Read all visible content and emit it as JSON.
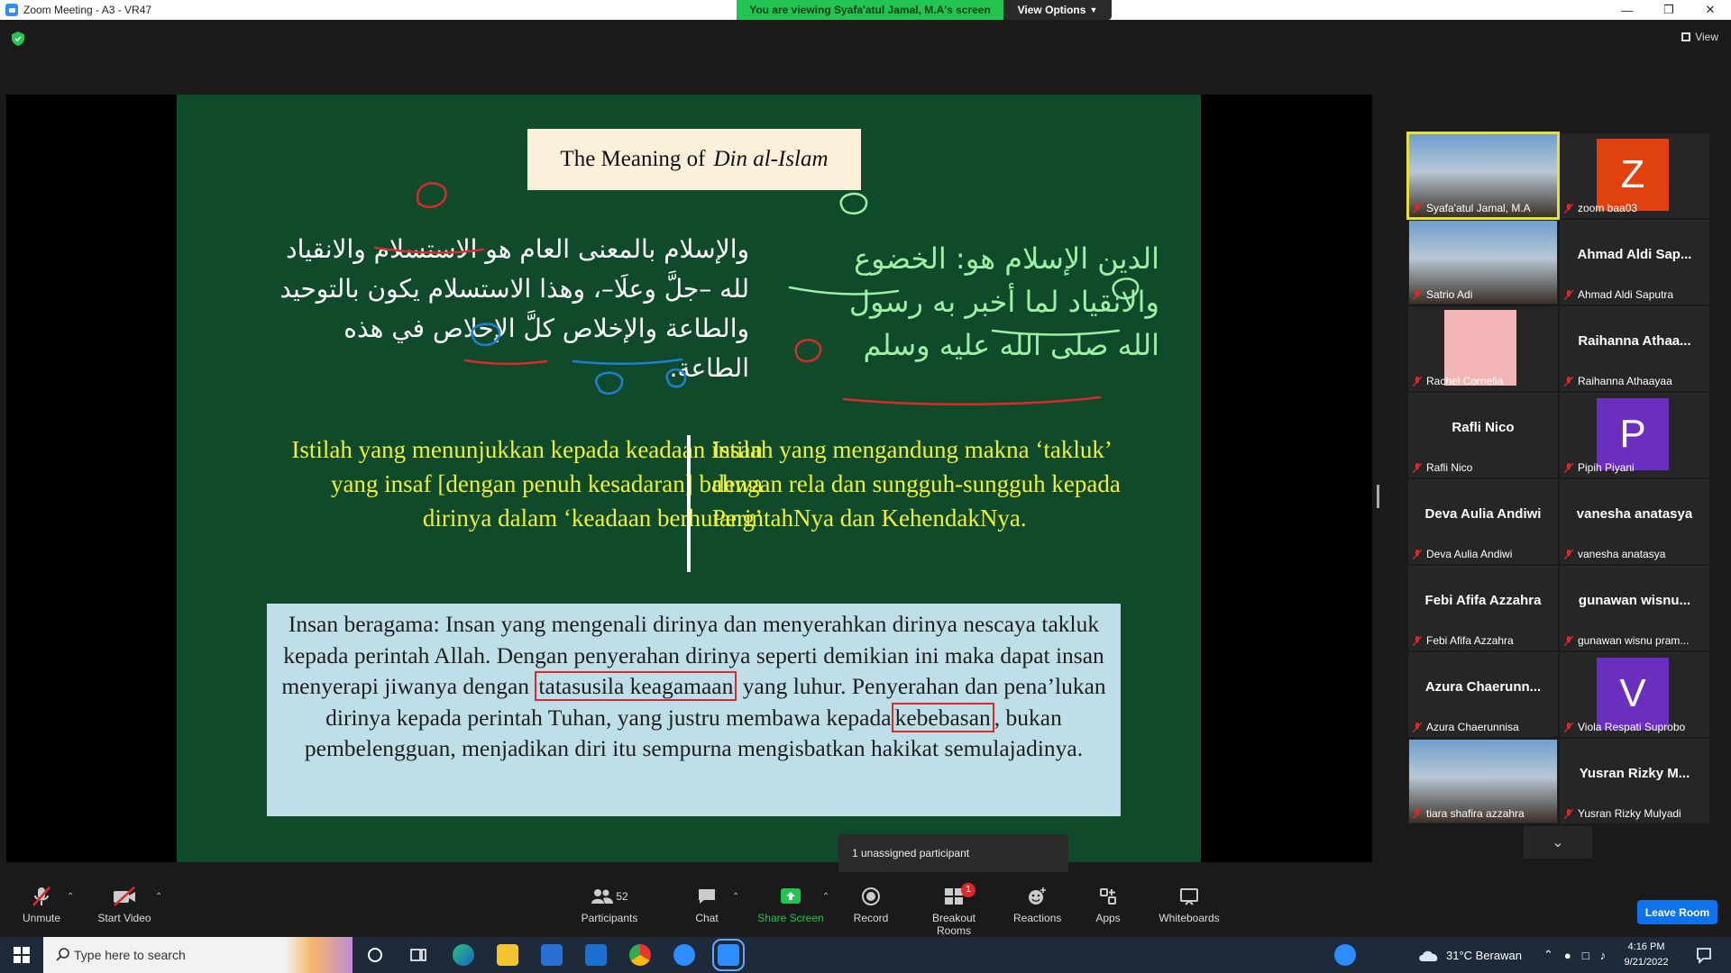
{
  "window": {
    "title": "Zoom Meeting - A3 - VR47",
    "share_banner": "You are viewing Syafa'atul Jamal, M.A's screen",
    "view_options": "View Options"
  },
  "top_right": {
    "view_label": "View"
  },
  "slide": {
    "title_prefix": "The Meaning of",
    "title_italic": "Din al-Islam",
    "arabic_left": "والإسلام بالمعنى العام هو الاستسلام والانقياد لله –جلَّ وعلَا–، وهذا الاستسلام يكون بالتوحيد والطاعة والإخلاص كلَّ الإخلاص في هذه الطاعة.",
    "arabic_right_1": "الدين الإسلام هو: الخضوع",
    "arabic_right_2": "والانقياد لما أخبر به رسول",
    "arabic_right_3": "الله صلى الله عليه وسلم",
    "yellow_left": "Istilah yang menunjukkan kepada keadaan insan yang insaf [dengan penuh kesadaran] bahwa dirinya dalam ‘keadaan berhutang’",
    "yellow_right": "Istilah yang mengandung makna ‘takluk’ dengan rela dan sungguh-sungguh kepada PerintahNya dan KehendakNya.",
    "box_part1": "Insan beragama: Insan yang mengenali dirinya dan menyerahkan dirinya nescaya takluk kepada perintah Allah. Dengan penyerahan dirinya seperti demikian ini maka dapat insan menyerapi jiwanya dengan",
    "box_hl1": "tatasusila keagamaan",
    "box_part2": "yang luhur. Penyerahan dan pena’lukan dirinya kepada perintah Tuhan, yang justru membawa kepada",
    "box_hl2": "kebebasan",
    "box_part3": ", bukan pembelengguan, menjadikan diri itu sempurna mengisbatkan hakikat semulajadinya."
  },
  "gallery": [
    {
      "name": "Syafa'atul Jamal, M.A",
      "big": "",
      "type": "photo",
      "active": true
    },
    {
      "name": "zoom baa03",
      "big": "Z",
      "type": "letter",
      "color": "#e0410f"
    },
    {
      "name": "Satrio Adi",
      "big": "",
      "type": "photo"
    },
    {
      "name": "Ahmad Aldi Saputra",
      "big": "Ahmad Aldi Sap...",
      "type": "text"
    },
    {
      "name": "Rachel Cornelia",
      "big": "",
      "type": "pink"
    },
    {
      "name": "Raihanna Athaayaa",
      "big": "Raihanna Athaa...",
      "type": "text"
    },
    {
      "name": "Rafli Nico",
      "big": "Rafli Nico",
      "type": "text"
    },
    {
      "name": "Pipih Piyani",
      "big": "P",
      "type": "letter",
      "color": "#6b2fbf"
    },
    {
      "name": "Deva Aulia Andiwi",
      "big": "Deva Aulia Andiwi",
      "type": "text"
    },
    {
      "name": "vanesha anatasya",
      "big": "vanesha anatasya",
      "type": "text"
    },
    {
      "name": "Febi Afifa Azzahra",
      "big": "Febi Afifa Azzahra",
      "type": "text"
    },
    {
      "name": "gunawan wisnu pram...",
      "big": "gunawan  wisnu...",
      "type": "text"
    },
    {
      "name": "Azura Chaerunnisa",
      "big": "Azura  Chaerunn...",
      "type": "text"
    },
    {
      "name": "Viola Respati Suprobo",
      "big": "V",
      "type": "letter",
      "color": "#6b2fbf"
    },
    {
      "name": "tiara shafira azzahra",
      "big": "",
      "type": "photo"
    },
    {
      "name": "Yusran Rizky Mulyadi",
      "big": "Yusran Rizky M...",
      "type": "text"
    }
  ],
  "unassigned": "1 unassigned participant",
  "toolbar": {
    "unmute": "Unmute",
    "start_video": "Start Video",
    "participants": "Participants",
    "participants_count": "52",
    "chat": "Chat",
    "share_screen": "Share Screen",
    "record": "Record",
    "breakout_rooms": "Breakout Rooms",
    "breakout_badge": "1",
    "reactions": "Reactions",
    "apps": "Apps",
    "whiteboards": "Whiteboards",
    "leave": "Leave Room"
  },
  "taskbar": {
    "search_placeholder": "Type here to search",
    "weather": "31°C  Berawan",
    "time": "4:16 PM",
    "date": "9/21/2022"
  },
  "colors": {
    "slide_bg": "#0f4a2a",
    "banner_green": "#23c552",
    "annotation_red": "#d92b2b",
    "annotation_blue": "#1e7fd6",
    "annotation_green": "#9ff0a6",
    "leave_blue": "#0e72ed"
  }
}
